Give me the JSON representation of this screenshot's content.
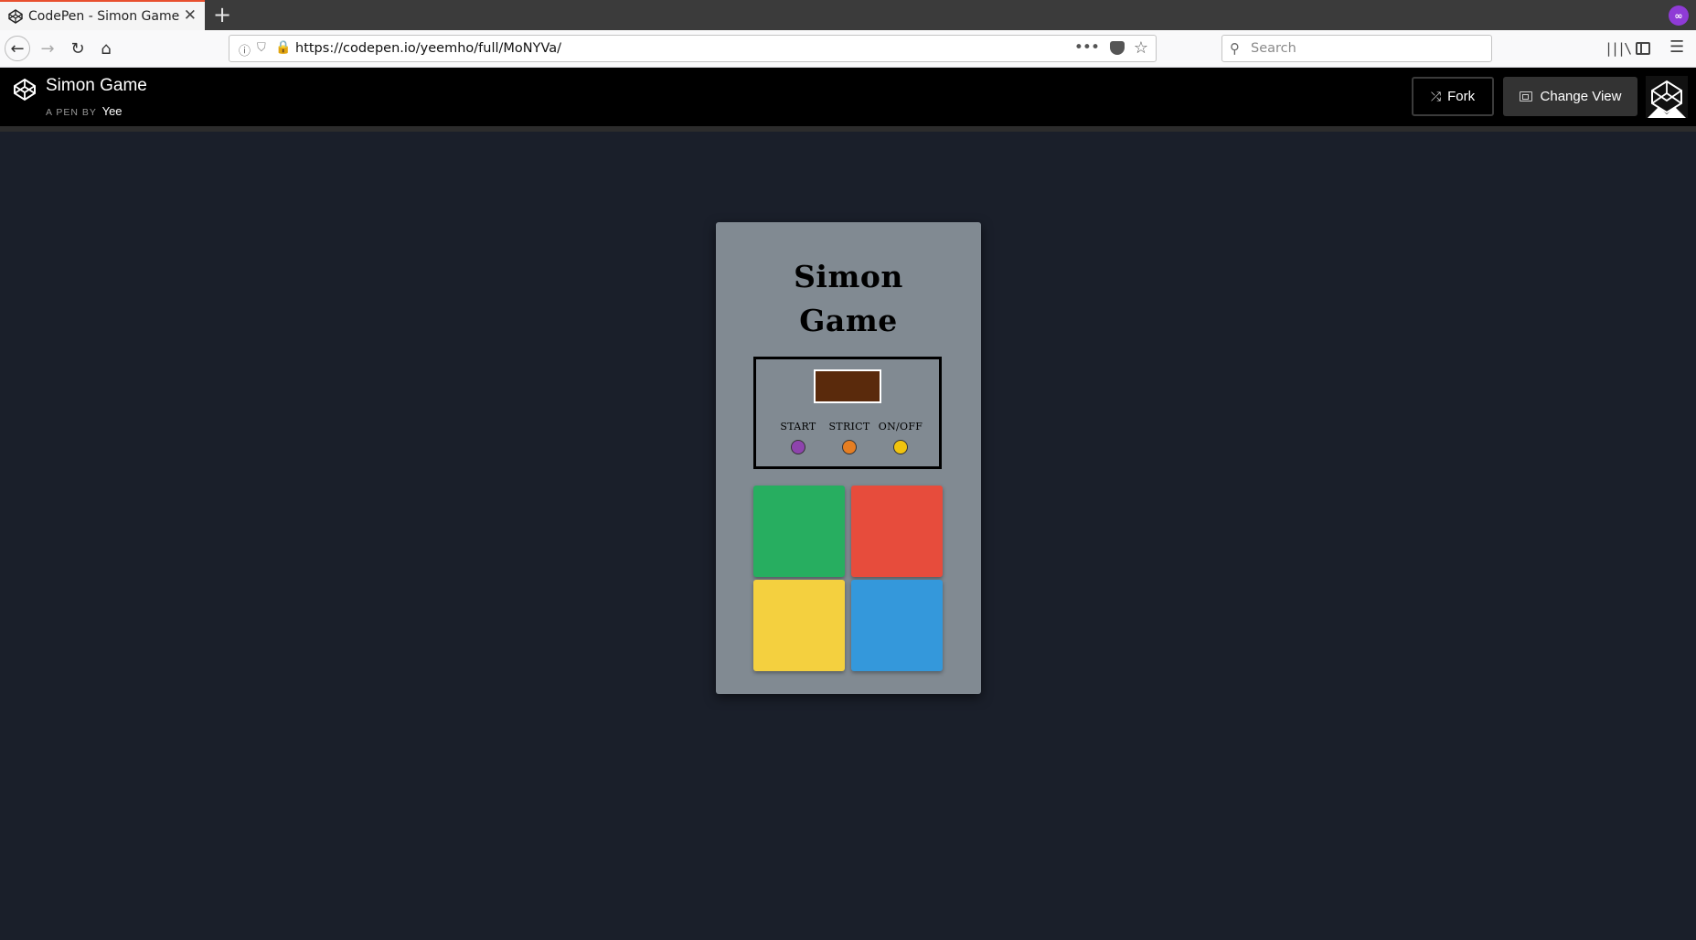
{
  "browser": {
    "tab_title": "CodePen - Simon Game",
    "tab_close": "✕",
    "new_tab": "+",
    "url": "https://codepen.io/yeemho/full/MoNYVa/",
    "search_placeholder": "Search"
  },
  "codepen": {
    "pen_title": "Simon Game",
    "byline": "A PEN BY",
    "author": "Yee",
    "fork_label": "Fork",
    "change_view_label": "Change View"
  },
  "game": {
    "title_line1": "Simon",
    "title_line2": "Game",
    "count_display": "",
    "controls": [
      {
        "label": "START",
        "color": "#8e44ad"
      },
      {
        "label": "STRICT",
        "color": "#e67e22"
      },
      {
        "label": "ON/OFF",
        "color": "#f1c40f"
      }
    ],
    "pads": [
      {
        "name": "green",
        "color": "#27ae60"
      },
      {
        "name": "red",
        "color": "#e74c3c"
      },
      {
        "name": "yellow",
        "color": "#f4d03f"
      },
      {
        "name": "blue",
        "color": "#3498db"
      }
    ]
  },
  "colors": {
    "page_background": "#1a1f2a",
    "card_background": "#818a92",
    "display_background": "#5a2a0c"
  }
}
